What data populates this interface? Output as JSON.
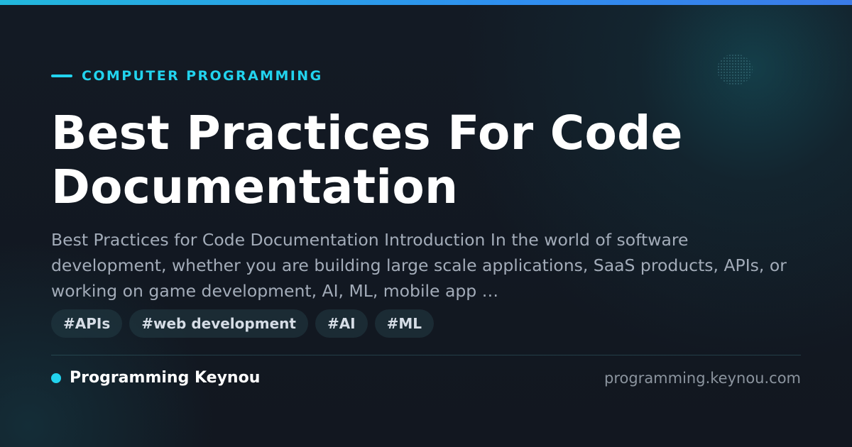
{
  "theme": {
    "accent": "#22d3ee",
    "background": "#121720",
    "title_color": "#ffffff",
    "excerpt_color": "#a3acb9",
    "url_color": "#8b949e"
  },
  "category": {
    "label": "COMPUTER PROGRAMMING"
  },
  "article": {
    "title": "Best Practices For Code Documentation",
    "excerpt": "Best Practices for Code Documentation Introduction In the world of software development, whether you are building large scale applications, SaaS products, APIs, or working on game development, AI, ML, mobile app …"
  },
  "tags": [
    {
      "label": "#APIs"
    },
    {
      "label": "#web development"
    },
    {
      "label": "#AI"
    },
    {
      "label": "#ML"
    }
  ],
  "footer": {
    "brand": "Programming Keynou",
    "url": "programming.keynou.com"
  }
}
